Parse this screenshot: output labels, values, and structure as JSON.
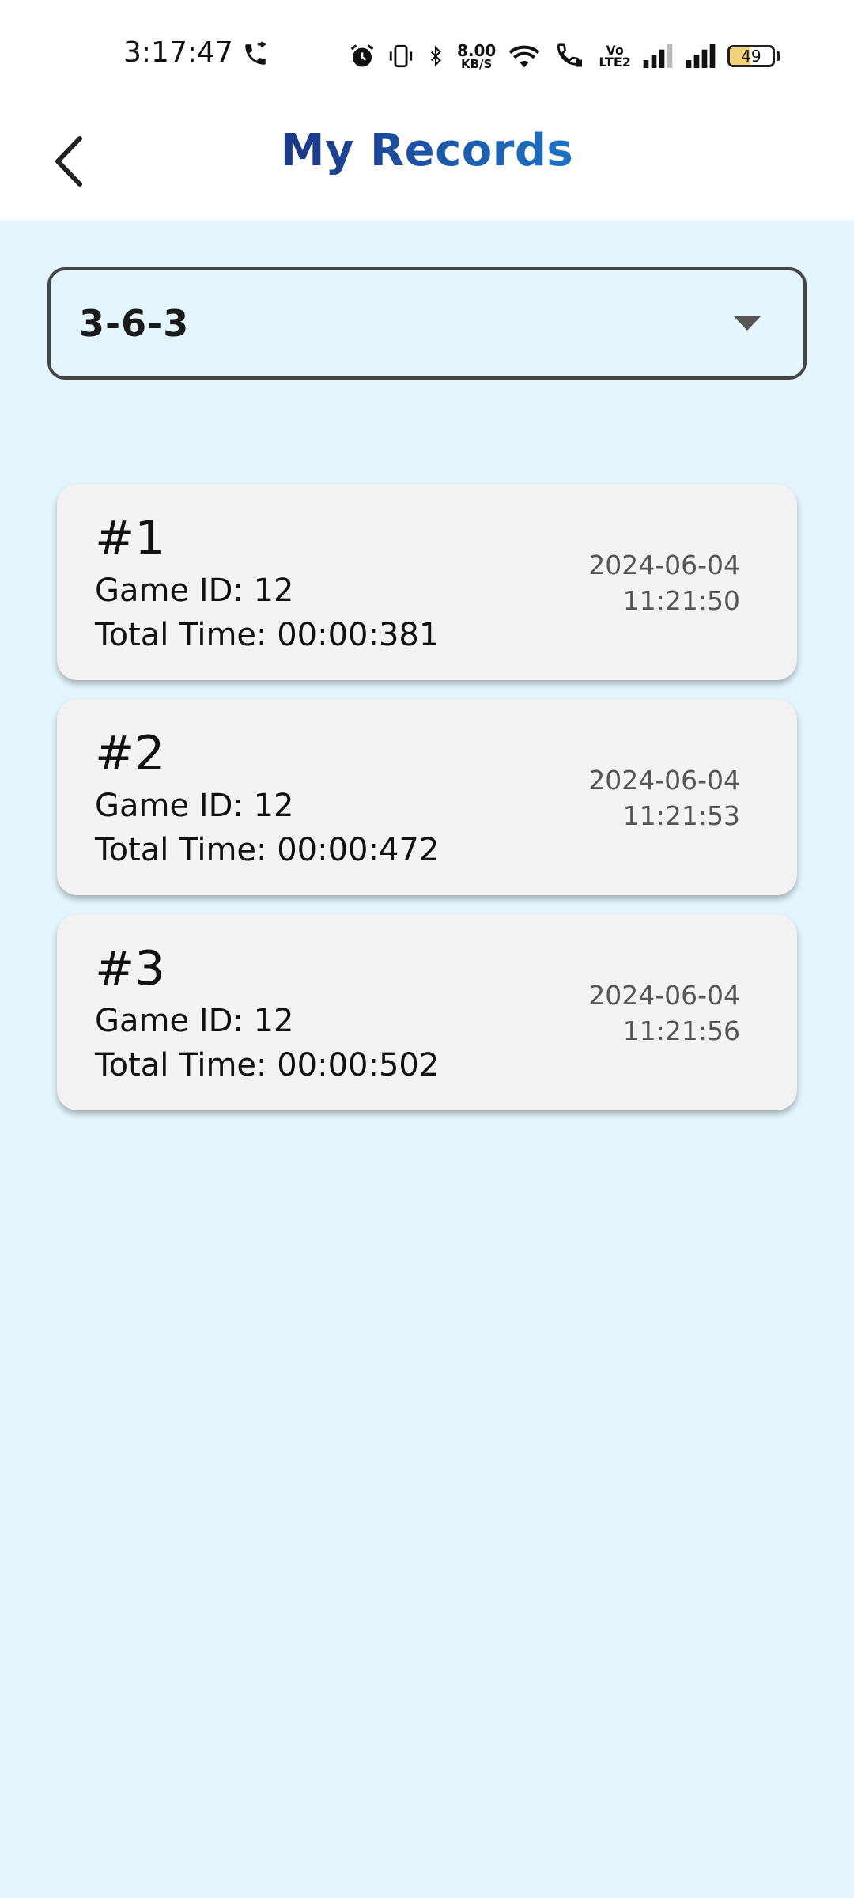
{
  "status_bar": {
    "time": "3:17:47",
    "net_speed_value": "8.00",
    "net_speed_unit": "KB/S",
    "volte_top": "Vo",
    "volte_bottom": "LTE2",
    "battery_level": "49",
    "battery_fraction": 0.49,
    "battery_color": "#f1d27b",
    "icons": [
      "call-icon",
      "alarm-icon",
      "vibrate-icon",
      "bluetooth-icon",
      "wifi-icon",
      "wifi-call-icon",
      "signal-icon",
      "signal-icon",
      "battery-icon"
    ]
  },
  "app_bar": {
    "title": "My Records",
    "back_icon": "chevron-left-icon",
    "title_gradient": [
      "#1b2463",
      "#1d9ad6"
    ]
  },
  "filter": {
    "selected": "3-6-3",
    "icon": "dropdown-arrow-icon"
  },
  "records": [
    {
      "rank": "#1",
      "game_id": "Game ID: 12",
      "total_time": "Total Time: 00:00:381",
      "date": "2024-06-04",
      "time": "11:21:50"
    },
    {
      "rank": "#2",
      "game_id": "Game ID: 12",
      "total_time": "Total Time: 00:00:472",
      "date": "2024-06-04",
      "time": "11:21:53"
    },
    {
      "rank": "#3",
      "game_id": "Game ID: 12",
      "total_time": "Total Time: 00:00:502",
      "date": "2024-06-04",
      "time": "11:21:56"
    }
  ],
  "colors": {
    "background": "#e3f5fd",
    "card": "#f3f3f3"
  }
}
